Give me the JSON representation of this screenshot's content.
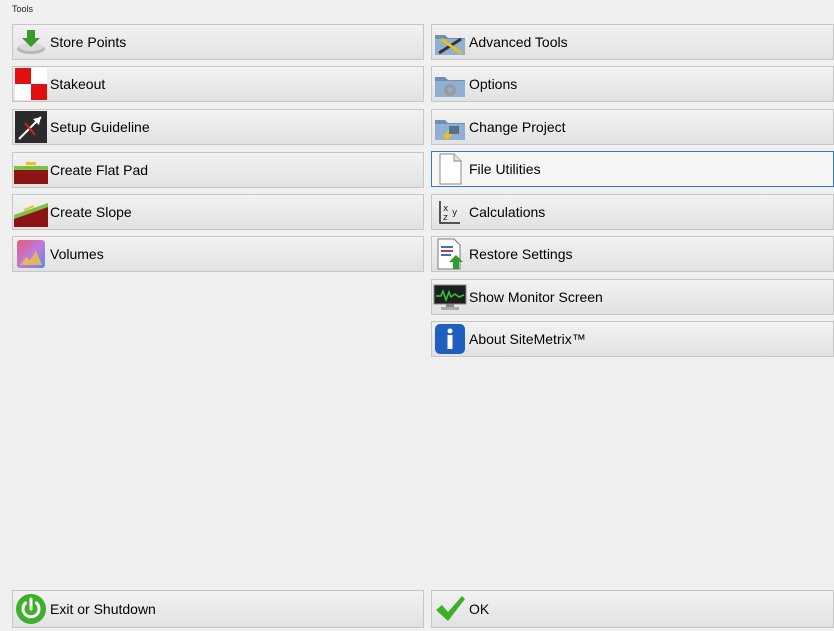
{
  "window": {
    "title": "Tools"
  },
  "left_buttons": [
    {
      "label": "Store Points",
      "icon": "store-points-icon"
    },
    {
      "label": "Stakeout",
      "icon": "stakeout-icon"
    },
    {
      "label": "Setup Guideline",
      "icon": "guideline-icon"
    },
    {
      "label": "Create Flat Pad",
      "icon": "flat-pad-icon"
    },
    {
      "label": "Create Slope",
      "icon": "slope-icon"
    },
    {
      "label": "Volumes",
      "icon": "volumes-icon"
    }
  ],
  "right_buttons": [
    {
      "label": "Advanced Tools",
      "icon": "advanced-tools-icon"
    },
    {
      "label": "Options",
      "icon": "options-icon"
    },
    {
      "label": "Change Project",
      "icon": "change-project-icon"
    },
    {
      "label": "File Utilities",
      "icon": "file-icon"
    },
    {
      "label": "Calculations",
      "icon": "xyz-icon"
    },
    {
      "label": "Restore Settings",
      "icon": "restore-icon"
    },
    {
      "label": "Show Monitor Screen",
      "icon": "monitor-icon"
    },
    {
      "label": "About SiteMetrix™",
      "icon": "info-icon"
    }
  ],
  "footer": {
    "exit_label": "Exit or Shutdown",
    "ok_label": "OK"
  },
  "colors": {
    "focus_border": "#2b7bd6",
    "button_border": "#c6c6c6",
    "ok_green": "#3fae2a",
    "info_blue": "#1f5fbf"
  }
}
